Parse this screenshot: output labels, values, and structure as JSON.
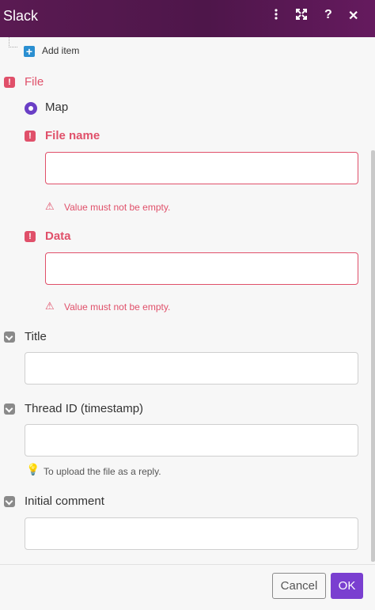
{
  "app": {
    "title": "Slack"
  },
  "header": {
    "icons": [
      "more-vertical-icon",
      "expand-icon",
      "help-icon",
      "close-icon"
    ],
    "help_glyph": "?",
    "close_glyph": "✕"
  },
  "add_item": {
    "label": "Add item"
  },
  "file": {
    "label": "File",
    "mode": "Map",
    "file_name": {
      "label": "File name",
      "value": "",
      "error": "Value must not be empty."
    },
    "data": {
      "label": "Data",
      "value": "",
      "error": "Value must not be empty."
    }
  },
  "title_field": {
    "label": "Title",
    "value": ""
  },
  "thread_field": {
    "label": "Thread ID (timestamp)",
    "value": "",
    "hint": "To upload the file as a reply."
  },
  "comment_field": {
    "label": "Initial comment",
    "value": ""
  },
  "footer": {
    "cancel_label": "Cancel",
    "ok_label": "OK"
  },
  "colors": {
    "header": "#5a1a52",
    "error": "#e0506a",
    "accent": "#7a3fd0",
    "radio": "#6a3fc6",
    "add": "#2a8fd1"
  }
}
